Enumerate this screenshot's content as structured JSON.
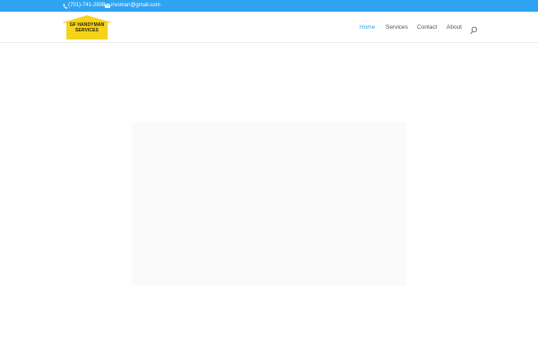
{
  "topbar": {
    "phone": "(701)-741-2808",
    "email": "irvoman@gmail.com",
    "background_color": "#2ea3f2",
    "phone_icon": "phone-icon",
    "email_icon": "envelope-icon"
  },
  "header": {
    "logo": {
      "line1": "GF HANDYMAN",
      "line2": "SERVICES",
      "color": "#f5d31a"
    },
    "nav": {
      "home": "Home",
      "services": "Services",
      "contact": "Contact",
      "about": "About"
    },
    "active_nav": "Home",
    "accent_color": "#2ea3f2",
    "search_icon": "search-icon"
  },
  "main": {
    "panel_color": "#fafafa"
  }
}
